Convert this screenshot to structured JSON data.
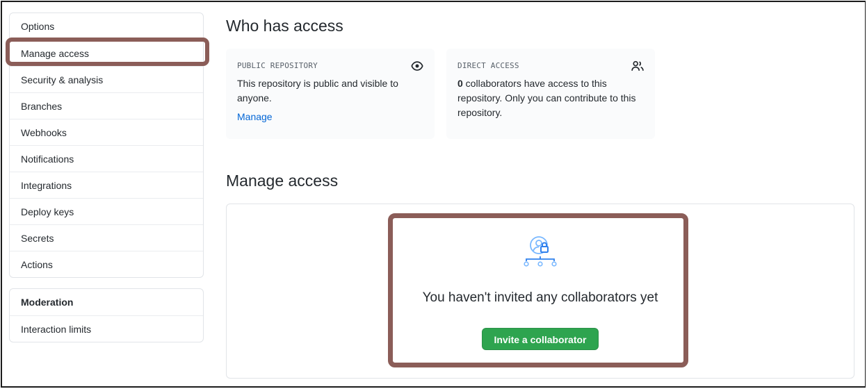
{
  "sidebar": {
    "items": [
      {
        "label": "Options"
      },
      {
        "label": "Manage access"
      },
      {
        "label": "Security & analysis"
      },
      {
        "label": "Branches"
      },
      {
        "label": "Webhooks"
      },
      {
        "label": "Notifications"
      },
      {
        "label": "Integrations"
      },
      {
        "label": "Deploy keys"
      },
      {
        "label": "Secrets"
      },
      {
        "label": "Actions"
      }
    ],
    "selected": "Manage access",
    "moderation": {
      "heading": "Moderation",
      "items": [
        {
          "label": "Interaction limits"
        }
      ]
    }
  },
  "who_has_access": {
    "title": "Who has access",
    "public_repository": {
      "label": "PUBLIC REPOSITORY",
      "icon": "eye-icon",
      "text": "This repository is public and visible to anyone.",
      "link": "Manage"
    },
    "direct_access": {
      "label": "DIRECT ACCESS",
      "icon": "people-icon",
      "count": "0",
      "text": " collaborators have access to this repository. Only you can contribute to this repository."
    }
  },
  "manage_access": {
    "title": "Manage access",
    "empty_icon": "collaborators-lock-icon",
    "empty_title": "You haven't invited any collaborators yet",
    "invite_button": "Invite a collaborator"
  },
  "colors": {
    "highlight": "#8b5d58",
    "link": "#0366d6",
    "primary_button": "#2ea44f",
    "icon_blue": "#4a8fe0"
  }
}
